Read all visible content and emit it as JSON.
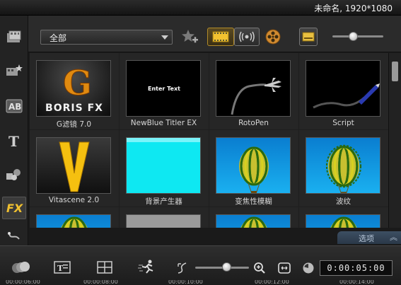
{
  "window": {
    "title": "未命名, 1920*1080"
  },
  "sidebar": {
    "items": [
      {
        "name": "media"
      },
      {
        "name": "instant-project"
      },
      {
        "name": "transition"
      },
      {
        "name": "title"
      },
      {
        "name": "graphic"
      },
      {
        "name": "filter",
        "label": "FX",
        "active": true
      },
      {
        "name": "path"
      }
    ]
  },
  "toolbar": {
    "category": "全部",
    "zoom_level": 0.32
  },
  "library": {
    "items": [
      {
        "label": "G滤镜 7.0",
        "thumb": "boris",
        "thumb_text": "BORIS FX"
      },
      {
        "label": "NewBlue Titler EX",
        "thumb": "enter-text",
        "thumb_text": "Enter Text"
      },
      {
        "label": "RotoPen",
        "thumb": "rotopen"
      },
      {
        "label": "Script",
        "thumb": "script"
      },
      {
        "label": "Vitascene 2.0",
        "thumb": "vitascene"
      },
      {
        "label": "背景产生器",
        "thumb": "cyan"
      },
      {
        "label": "变焦性模糊",
        "thumb": "balloon"
      },
      {
        "label": "波纹",
        "thumb": "balloon-ripple"
      },
      {
        "label": "",
        "thumb": "balloon-partial"
      },
      {
        "label": "",
        "thumb": "gray-partial"
      },
      {
        "label": "",
        "thumb": "balloon-partial"
      },
      {
        "label": "",
        "thumb": "balloon-partial"
      }
    ]
  },
  "options": {
    "label": "选项"
  },
  "playback": {
    "timecode": "0:00:05:00",
    "zoom_level": 0.65
  },
  "ruler": {
    "ticks": [
      "00:00:06:00",
      "00:00:08:00",
      "00:00:10:00",
      "00:00:12:00",
      "00:00:14:00"
    ]
  },
  "colors": {
    "accent": "#b08a2a",
    "cyan": "#00e0f0",
    "sky": "#1aa0e0"
  }
}
